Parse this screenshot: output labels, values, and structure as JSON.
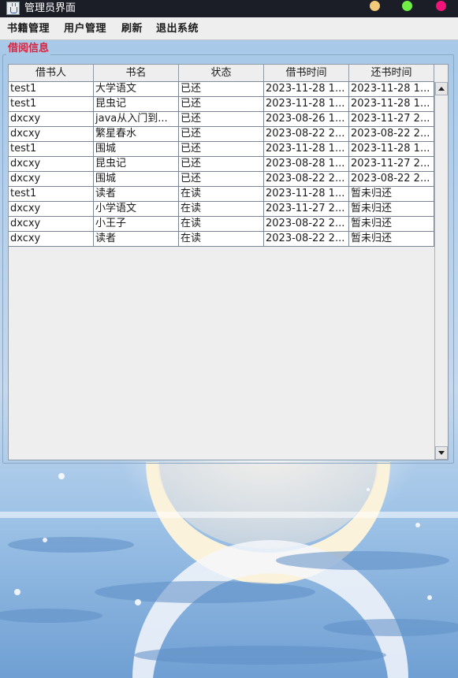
{
  "window": {
    "title": "管理员界面",
    "controls": {
      "minimize_color": "#f3c97a",
      "maximize_color": "#70ee45",
      "close_color": "#f31479"
    }
  },
  "menu": {
    "items": [
      "书籍管理",
      "用户管理",
      "刷新",
      "退出系统"
    ]
  },
  "panel": {
    "title": "借阅信息",
    "title_color": "#d42640"
  },
  "table": {
    "columns": [
      "借书人",
      "书名",
      "状态",
      "借书时间",
      "还书时间"
    ],
    "rows": [
      [
        "test1",
        "大学语文",
        "已还",
        "2023-11-28 1...",
        "2023-11-28 1..."
      ],
      [
        "test1",
        "昆虫记",
        "已还",
        "2023-11-28 1...",
        "2023-11-28 1..."
      ],
      [
        "dxcxy",
        "java从入门到...",
        "已还",
        "2023-08-26 1...",
        "2023-11-27 2..."
      ],
      [
        "dxcxy",
        "繁星春水",
        "已还",
        "2023-08-22 2...",
        "2023-08-22 2..."
      ],
      [
        "test1",
        "围城",
        "已还",
        "2023-11-28 1...",
        "2023-11-28 1..."
      ],
      [
        "dxcxy",
        "昆虫记",
        "已还",
        "2023-08-28 1...",
        "2023-11-27 2..."
      ],
      [
        "dxcxy",
        "围城",
        "已还",
        "2023-08-22 2...",
        "2023-08-22 2..."
      ],
      [
        "test1",
        "读者",
        "在读",
        "2023-11-28 1...",
        "暂未归还"
      ],
      [
        "dxcxy",
        "小学语文",
        "在读",
        "2023-11-27 2...",
        "暂未归还"
      ],
      [
        "dxcxy",
        "小王子",
        "在读",
        "2023-08-22 2...",
        "暂未归还"
      ],
      [
        "dxcxy",
        "读者",
        "在读",
        "2023-08-22 2...",
        "暂未归还"
      ]
    ]
  },
  "scrollbar": {
    "up_icon": "arrow-up-icon",
    "down_icon": "arrow-down-icon"
  },
  "icons": {
    "app": "java-cup-icon"
  }
}
